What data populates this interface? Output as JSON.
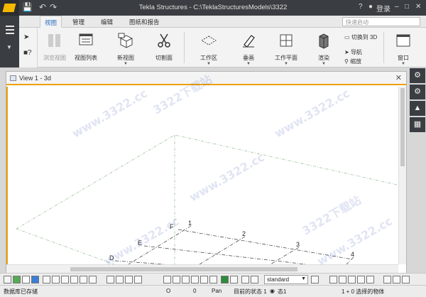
{
  "app": {
    "title": "Tekla Structures - C:\\TeklaStructuresModels\\3322",
    "help": "?",
    "login": "登录"
  },
  "tabs": [
    {
      "label": "视图"
    },
    {
      "label": "管理"
    },
    {
      "label": "编辑"
    },
    {
      "label": "图纸和报告"
    }
  ],
  "search": {
    "placeholder": "快速启动"
  },
  "ribbon": {
    "buttons": [
      {
        "label": "浏览视图"
      },
      {
        "label": "视图列表"
      },
      {
        "label": "新视图"
      },
      {
        "label": "切割面"
      },
      {
        "label": "工作区"
      },
      {
        "label": "垂画"
      },
      {
        "label": "工作平面"
      },
      {
        "label": "渲染"
      },
      {
        "label": "窗口"
      }
    ],
    "switch_3d": "切换到 3D",
    "navigate": "导航",
    "zoom": "缩放"
  },
  "view": {
    "title": "View 1 - 3d"
  },
  "grid_labels": [
    "F",
    "E",
    "D",
    "1",
    "2",
    "3",
    "4"
  ],
  "watermark": "www.3322.cc",
  "watermark2": "3322下载站",
  "toolbar": {
    "combo_value": "standard"
  },
  "status": {
    "left": "数据库已存储",
    "v1": "O",
    "v2": "0",
    "mode": "Pan",
    "state": "目前的状态 1",
    "state2": "态1",
    "selected": "1 + 0 选择的物体"
  }
}
